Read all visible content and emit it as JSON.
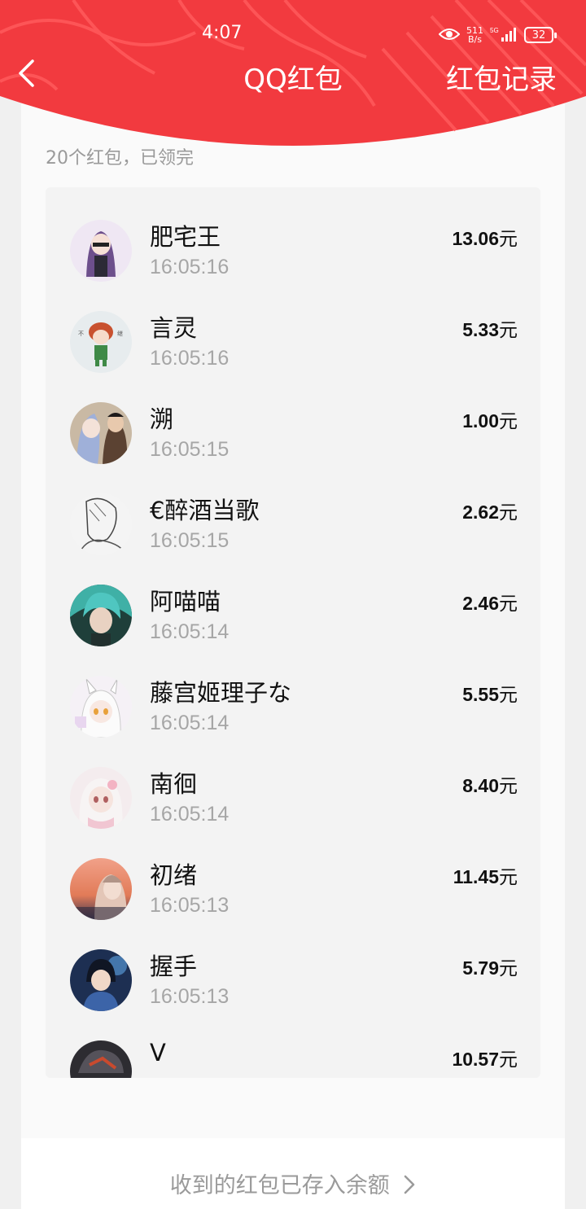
{
  "status_bar": {
    "time": "4:07",
    "net_speed_value": "511",
    "net_speed_unit": "B/s",
    "network": "5G",
    "battery": "32"
  },
  "nav": {
    "title": "QQ红包",
    "records_label": "红包记录"
  },
  "summary": "20个红包，已领完",
  "currency_unit": "元",
  "recipients": [
    {
      "name": "肥宅王",
      "time": "16:05:16",
      "amount": "13.06",
      "avatar_color": "#e9dff0"
    },
    {
      "name": "言灵",
      "time": "16:05:16",
      "amount": "5.33",
      "avatar_color": "#e7ecee"
    },
    {
      "name": "溯",
      "time": "16:05:15",
      "amount": "1.00",
      "avatar_color": "#6a4b39"
    },
    {
      "name": "€醉酒当歌",
      "time": "16:05:15",
      "amount": "2.62",
      "avatar_color": "#f2f2f2"
    },
    {
      "name": "阿喵喵",
      "time": "16:05:14",
      "amount": "2.46",
      "avatar_color": "#2f8f8b"
    },
    {
      "name": "藤宫姬理子な",
      "time": "16:05:14",
      "amount": "5.55",
      "avatar_color": "#f3eef4"
    },
    {
      "name": "南徊",
      "time": "16:05:14",
      "amount": "8.40",
      "avatar_color": "#f1e3e5"
    },
    {
      "name": "初绪",
      "time": "16:05:13",
      "amount": "11.45",
      "avatar_color": "#d98b6a"
    },
    {
      "name": "握手",
      "time": "16:05:13",
      "amount": "5.79",
      "avatar_color": "#2e4c7a"
    },
    {
      "name": "V",
      "time": "",
      "amount": "10.57",
      "avatar_color": "#3a3a3e"
    }
  ],
  "footer_link": "收到的红包已存入余额",
  "colors": {
    "header_red": "#f23a3f",
    "header_pattern": "#ff5a5c"
  }
}
